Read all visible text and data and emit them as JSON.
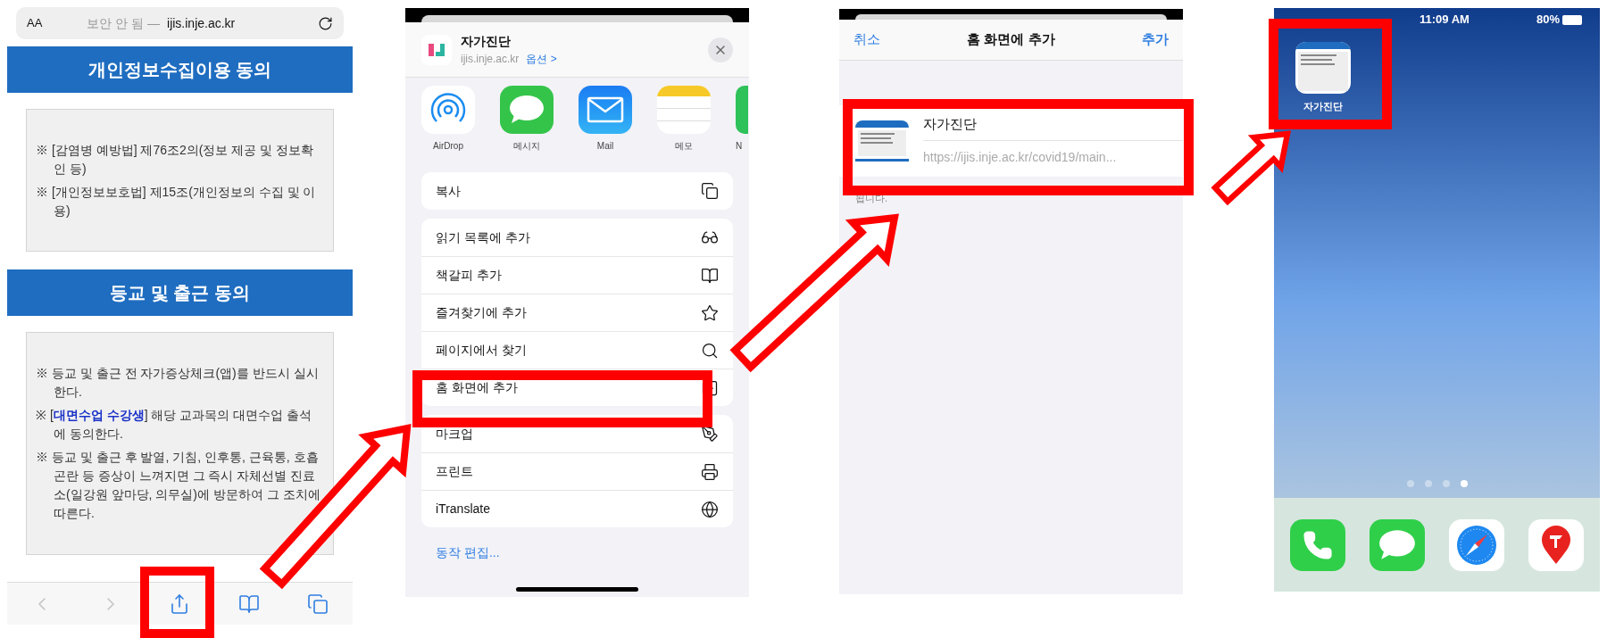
{
  "browser_screen": {
    "address_bar": {
      "text_size_button": "AA",
      "security_label": "보안 안 됨 —",
      "domain": "ijis.inje.ac.kr"
    },
    "sections": [
      {
        "title": "개인정보수집이용 동의",
        "items": [
          "※ [감염병 예방법] 제76조2의(정보 제공 및 정보확인 등)",
          "※ [개인정보보호법] 제15조(개인정보의 수집 및 이용)"
        ]
      },
      {
        "title": "등교 및 출근 동의",
        "items": [
          "※ 등교 및 출근 전 자가증상체크(앱)를 반드시 실시한다.",
          "※ [**대면수업 수강생**] 해당 교과목의 대면수업 출석에 동의한다.",
          "※ 등교 및 출근 후 발열, 기침, 인후통, 근육통, 호흡곤란 등 증상이 느껴지면 그 즉시 자체선별 진료소(일강원 앞마당, 의무실)에 방문하여 그 조치에 따른다."
        ]
      }
    ],
    "toolbar": [
      {
        "kind": "back",
        "disabled": true
      },
      {
        "kind": "forward",
        "disabled": true
      },
      {
        "kind": "share",
        "disabled": false
      },
      {
        "kind": "bookmarks",
        "disabled": false
      },
      {
        "kind": "tabs",
        "disabled": false
      }
    ]
  },
  "share_sheet": {
    "title": "자가진단",
    "domain": "ijis.inje.ac.kr",
    "options_link": "옵션 >",
    "apps": [
      {
        "kind": "airdrop",
        "label": "AirDrop"
      },
      {
        "kind": "messages",
        "label": "메시지"
      },
      {
        "kind": "mail",
        "label": "Mail"
      },
      {
        "kind": "notes",
        "label": "메모"
      },
      {
        "kind": "partial",
        "label": "N"
      }
    ],
    "action_groups": [
      [
        {
          "label": "복사",
          "kind": "copy"
        }
      ],
      [
        {
          "label": "읽기 목록에 추가",
          "kind": "glasses"
        },
        {
          "label": "책갈피 추가",
          "kind": "book"
        },
        {
          "label": "즐겨찾기에 추가",
          "kind": "star"
        },
        {
          "label": "페이지에서 찾기",
          "kind": "search"
        },
        {
          "label": "홈 화면에 추가",
          "kind": "plus-square"
        }
      ],
      [
        {
          "label": "마크업",
          "kind": "markup"
        },
        {
          "label": "프린트",
          "kind": "printer"
        },
        {
          "label": "iTranslate",
          "kind": "globe"
        }
      ]
    ],
    "edit_actions": "동작 편집..."
  },
  "add_to_home": {
    "cancel": "취소",
    "title": "홈 화면에 추가",
    "add": "추가",
    "name": "자가진단",
    "url": "https://ijis.inje.ac.kr/covid19/main...",
    "caption": "됩니다."
  },
  "home_screen": {
    "time": "11:09 AM",
    "battery": "80%",
    "app_label": "자가진단",
    "page_dots": [
      {
        "selected": false
      },
      {
        "selected": false
      },
      {
        "selected": false
      },
      {
        "selected": true
      }
    ],
    "dock": [
      {
        "kind": "phone"
      },
      {
        "kind": "messages"
      },
      {
        "kind": "safari"
      },
      {
        "kind": "map-pin"
      }
    ]
  }
}
